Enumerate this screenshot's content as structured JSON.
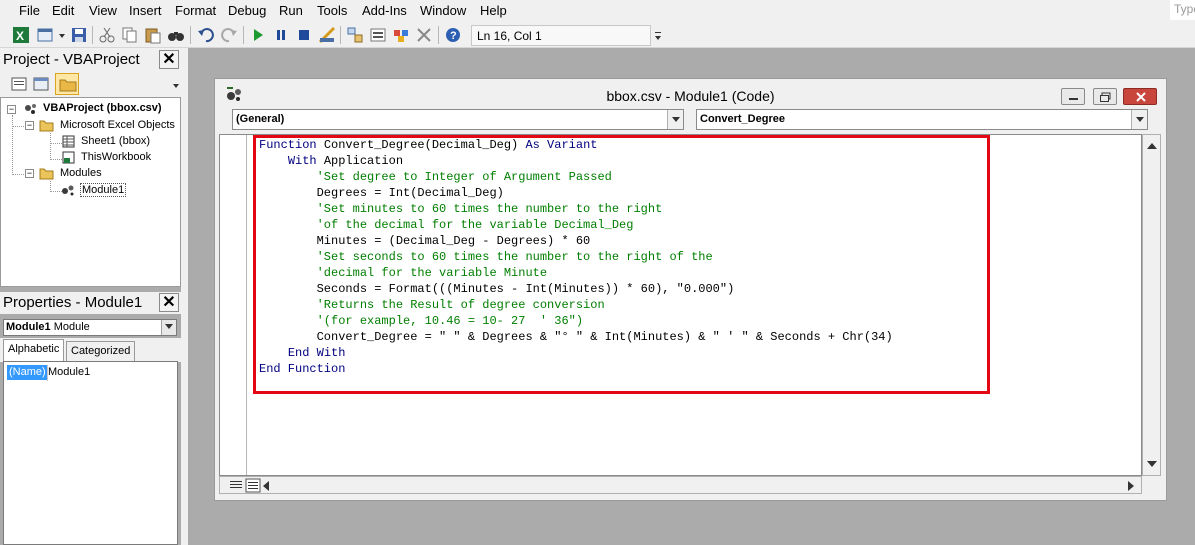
{
  "menu": [
    "File",
    "Edit",
    "View",
    "Insert",
    "Format",
    "Debug",
    "Run",
    "Tools",
    "Add-Ins",
    "Window",
    "Help"
  ],
  "help_search_placeholder": "Type",
  "toolbar": {
    "cursor_position": "Ln 16, Col 1"
  },
  "project": {
    "title": "Project - VBAProject",
    "tree": {
      "root": "VBAProject (bbox.csv)",
      "excel_objects_folder": "Microsoft Excel Objects",
      "sheet1": "Sheet1 (bbox)",
      "thisworkbook": "ThisWorkbook",
      "modules_folder": "Modules",
      "module1": "Module1"
    }
  },
  "properties": {
    "title": "Properties - Module1",
    "object_name": "Module1",
    "object_type": "Module",
    "tabs": [
      "Alphabetic",
      "Categorized"
    ],
    "row_name": "(Name)",
    "row_value": "Module1"
  },
  "code_window": {
    "title": "bbox.csv - Module1 (Code)",
    "object_dropdown": "(General)",
    "procedure_dropdown": "Convert_Degree",
    "lines": [
      [
        {
          "t": "Function ",
          "c": "kw"
        },
        {
          "t": "Convert_Degree(Decimal_Deg) "
        },
        {
          "t": "As Variant",
          "c": "kw"
        }
      ],
      [
        {
          "t": "    "
        },
        {
          "t": "With",
          "c": "kw"
        },
        {
          "t": " Application"
        }
      ],
      [
        {
          "t": "        "
        },
        {
          "t": "'Set degree to Integer of Argument Passed",
          "c": "cm"
        }
      ],
      [
        {
          "t": "        Degrees = Int(Decimal_Deg)"
        }
      ],
      [
        {
          "t": "        "
        },
        {
          "t": "'Set minutes to 60 times the number to the right",
          "c": "cm"
        }
      ],
      [
        {
          "t": "        "
        },
        {
          "t": "'of the decimal for the variable Decimal_Deg",
          "c": "cm"
        }
      ],
      [
        {
          "t": "        Minutes = (Decimal_Deg - Degrees) * 60"
        }
      ],
      [
        {
          "t": "        "
        },
        {
          "t": "'Set seconds to 60 times the number to the right of the",
          "c": "cm"
        }
      ],
      [
        {
          "t": "        "
        },
        {
          "t": "'decimal for the variable Minute",
          "c": "cm"
        }
      ],
      [
        {
          "t": "        Seconds = Format(((Minutes - Int(Minutes)) * 60), \"0.000\")"
        }
      ],
      [
        {
          "t": "        "
        },
        {
          "t": "'Returns the Result of degree conversion",
          "c": "cm"
        }
      ],
      [
        {
          "t": "        "
        },
        {
          "t": "'(for example, 10.46 = 10- 27  ' 36\")",
          "c": "cm"
        }
      ],
      [
        {
          "t": "        Convert_Degree = \" \" & Degrees & \"° \" & Int(Minutes) & \" ' \" & Seconds + Chr(34)"
        }
      ],
      [
        {
          "t": "    "
        },
        {
          "t": "End With",
          "c": "kw"
        }
      ],
      [
        {
          "t": "End Function",
          "c": "kw"
        }
      ]
    ]
  },
  "colors": {
    "keyword": "#00007f",
    "comment": "#007f00",
    "highlight_border": "#e30613",
    "selection": "#3399ff"
  }
}
